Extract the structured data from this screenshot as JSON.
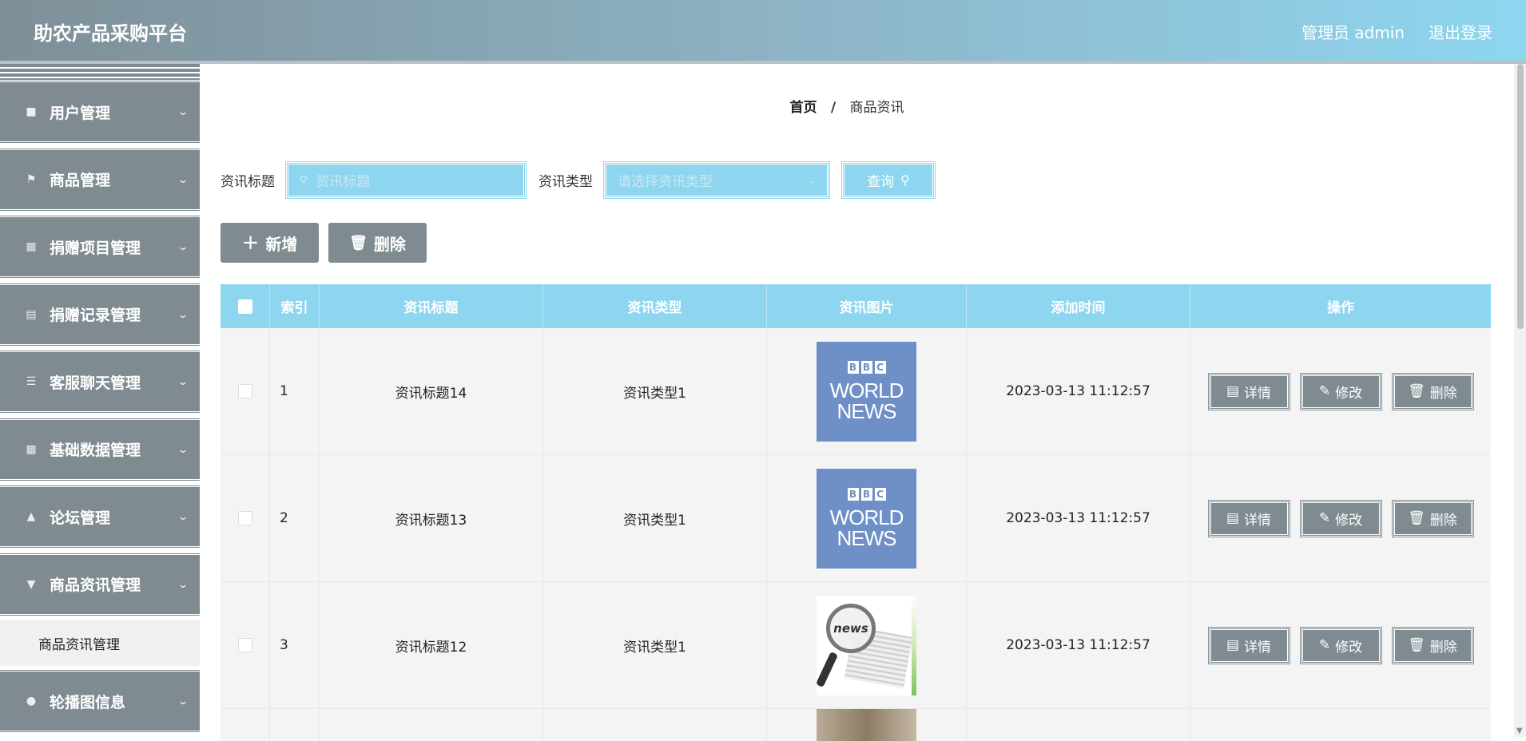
{
  "header": {
    "title": "助农产品采购平台",
    "user_label": "管理员 admin",
    "logout_label": "退出登录"
  },
  "sidebar": {
    "items": [
      {
        "label": "用户管理",
        "icon": "briefcase-icon"
      },
      {
        "label": "商品管理",
        "icon": "flag-icon"
      },
      {
        "label": "捐赠项目管理",
        "icon": "grid-icon"
      },
      {
        "label": "捐赠记录管理",
        "icon": "clipboard-icon"
      },
      {
        "label": "客服聊天管理",
        "icon": "list-icon"
      },
      {
        "label": "基础数据管理",
        "icon": "apps-icon"
      },
      {
        "label": "论坛管理",
        "icon": "stamp-icon"
      },
      {
        "label": "商品资讯管理",
        "icon": "brush-icon"
      },
      {
        "label": "轮播图信息",
        "icon": "user-icon"
      }
    ],
    "submenu": {
      "label": "商品资讯管理"
    }
  },
  "breadcrumb": {
    "home": "首页",
    "separator": "/",
    "current": "商品资讯"
  },
  "search": {
    "title_label": "资讯标题",
    "title_placeholder": "资讯标题",
    "type_label": "资讯类型",
    "type_placeholder": "请选择资讯类型",
    "query_label": "查询"
  },
  "actions": {
    "add_label": "新增",
    "delete_label": "删除"
  },
  "table": {
    "headers": {
      "index": "索引",
      "title": "资讯标题",
      "type": "资讯类型",
      "image": "资讯图片",
      "time": "添加时间",
      "ops": "操作"
    },
    "rows": [
      {
        "index": "1",
        "title": "资讯标题14",
        "type": "资讯类型1",
        "image": "bbc-world-news",
        "time": "2023-03-13 11:12:57"
      },
      {
        "index": "2",
        "title": "资讯标题13",
        "type": "资讯类型1",
        "image": "bbc-world-news",
        "time": "2023-03-13 11:12:57"
      },
      {
        "index": "3",
        "title": "资讯标题12",
        "type": "资讯类型1",
        "image": "news-magnifier",
        "time": "2023-03-13 11:12:57"
      }
    ],
    "op_labels": {
      "detail": "详情",
      "edit": "修改",
      "delete": "删除"
    },
    "bbc_image_text": {
      "logo": [
        "B",
        "B",
        "C"
      ],
      "line1": "WORLD",
      "line2": "NEWS"
    },
    "magnifier_text": "news"
  },
  "colors": {
    "accent": "#8ed6f0",
    "sidebar": "#7f8b91",
    "header_start": "#7e8f98",
    "header_end": "#8ed6f0"
  }
}
